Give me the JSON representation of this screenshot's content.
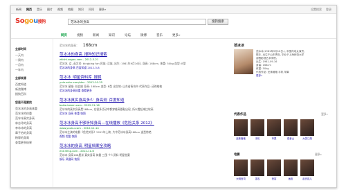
{
  "topnav": {
    "links": [
      "新闻",
      "网页",
      "音乐",
      "图片",
      "视频",
      "地图",
      "知识",
      "问问",
      "更多»"
    ],
    "active": "网页",
    "right": [
      "设置搜索",
      "登录"
    ]
  },
  "logo": {
    "part1": "So",
    "part2": "go",
    "part3": "u",
    "part4": "搜狗"
  },
  "search": {
    "query": "范冰冰的身高",
    "button": "搜狗搜索"
  },
  "tabs": [
    "网页",
    "视频",
    "新闻",
    "知识",
    "论坛",
    "微博",
    "音乐",
    "更多»"
  ],
  "left": {
    "time_header": "全部时间",
    "time_items": [
      "一天内",
      "一周内",
      "一月内",
      "一年内"
    ],
    "source_header": "全部来源",
    "source_items": [
      "百度知道",
      "新浪微博",
      "搜狗百科"
    ],
    "related_header": "您是不是要找",
    "related_items": [
      "范冰冰的身高体重",
      "范冰冰的体重",
      "范冰冰真实身高",
      "林志玲的身高",
      "李冰冰的身高",
      "章子怡的身高",
      "杨幂的身高",
      "查看更多结果"
    ]
  },
  "answer": {
    "label": "范冰冰的身高：",
    "value": "168cm"
  },
  "results": [
    {
      "title": "范冰冰的身高_搜狗知识搜索",
      "title_hl": "范冰冰的身高",
      "url": "zhishi.sogou.com - 2012-3-21",
      "snippet": "范冰冰, 女, 英文名: bingbing fan 民族: 汉族, 出生: 1981年9月16日, 身高: 168cm, 体重: 50kg 血型: B型",
      "sub": "范冰冰的身高 百度知道 2012-3-8"
    },
    {
      "title": "范冰冰_明星资料库_搜狐",
      "title_hl": "范冰冰",
      "url": "yule.sohu.com/star - 2012-10-25",
      "snippet": "范冰冰 星座: 处女座 身高: 168cm 血型: B型 出生地: 山东省青岛市 代表作品: 还珠格格",
      "sub": "范冰冰的身高体重 查看更多"
    },
    {
      "title": "范冰冰真实身高多少_身高测_百度知道",
      "title_hl": "范冰冰真实身高",
      "url": "baike.kaixin.com - 2012-11-16",
      "snippet": "范冰冰的真实身高是168cm, 在很多活动中都穿着高跟鞋出现, 所以看起来比较高",
      "sub": "范冰冰 身高 体重 快照"
    },
    {
      "title": "范冰冰身高不够听知身高—在线播放《危险关系 2012》",
      "title_hl": "范冰冰身高",
      "url": "www.youku.com - 2012-11-14",
      "snippet": "范冰冰主演的电影《危险关系》2012年上映, 片中范冰冰身高168cm 造型惊艳",
      "sub": "视频 优酷 快照"
    },
    {
      "title": "范冰冰的身高_明星档案全攻略",
      "title_hl": "范冰冰的身高",
      "url": "ent.ifeng.com - 2012-11-6",
      "snippet": "范冰冰 身高168厘米 真实身高 体重 三围 个人资料 明星档案",
      "sub": "娱乐 凤凰网 快照"
    }
  ],
  "card": {
    "name": "范冰冰",
    "info": [
      "范冰冰(1981年9月16日-), 中国内地女演员、",
      "歌手, 出生于山东青岛, 毕业于上海师范大学",
      "谢晋影视艺术学院。",
      "出生: 1981-09-16",
      "身高: 168cm",
      "体重: 50kg",
      "代表作品: 还珠格格 手机 苹果",
      "更多»"
    ]
  },
  "works_header": "代表作品",
  "works_more": "更多»",
  "works": [
    "还珠格格",
    "手机",
    "苹果",
    "观音山",
    "大笑江湖"
  ],
  "movies_header": "电影",
  "movies_more": "更多»",
  "movies": [
    "大明宫词",
    "墨攻",
    "夜宴",
    "画皮",
    "赵氏孤儿"
  ]
}
